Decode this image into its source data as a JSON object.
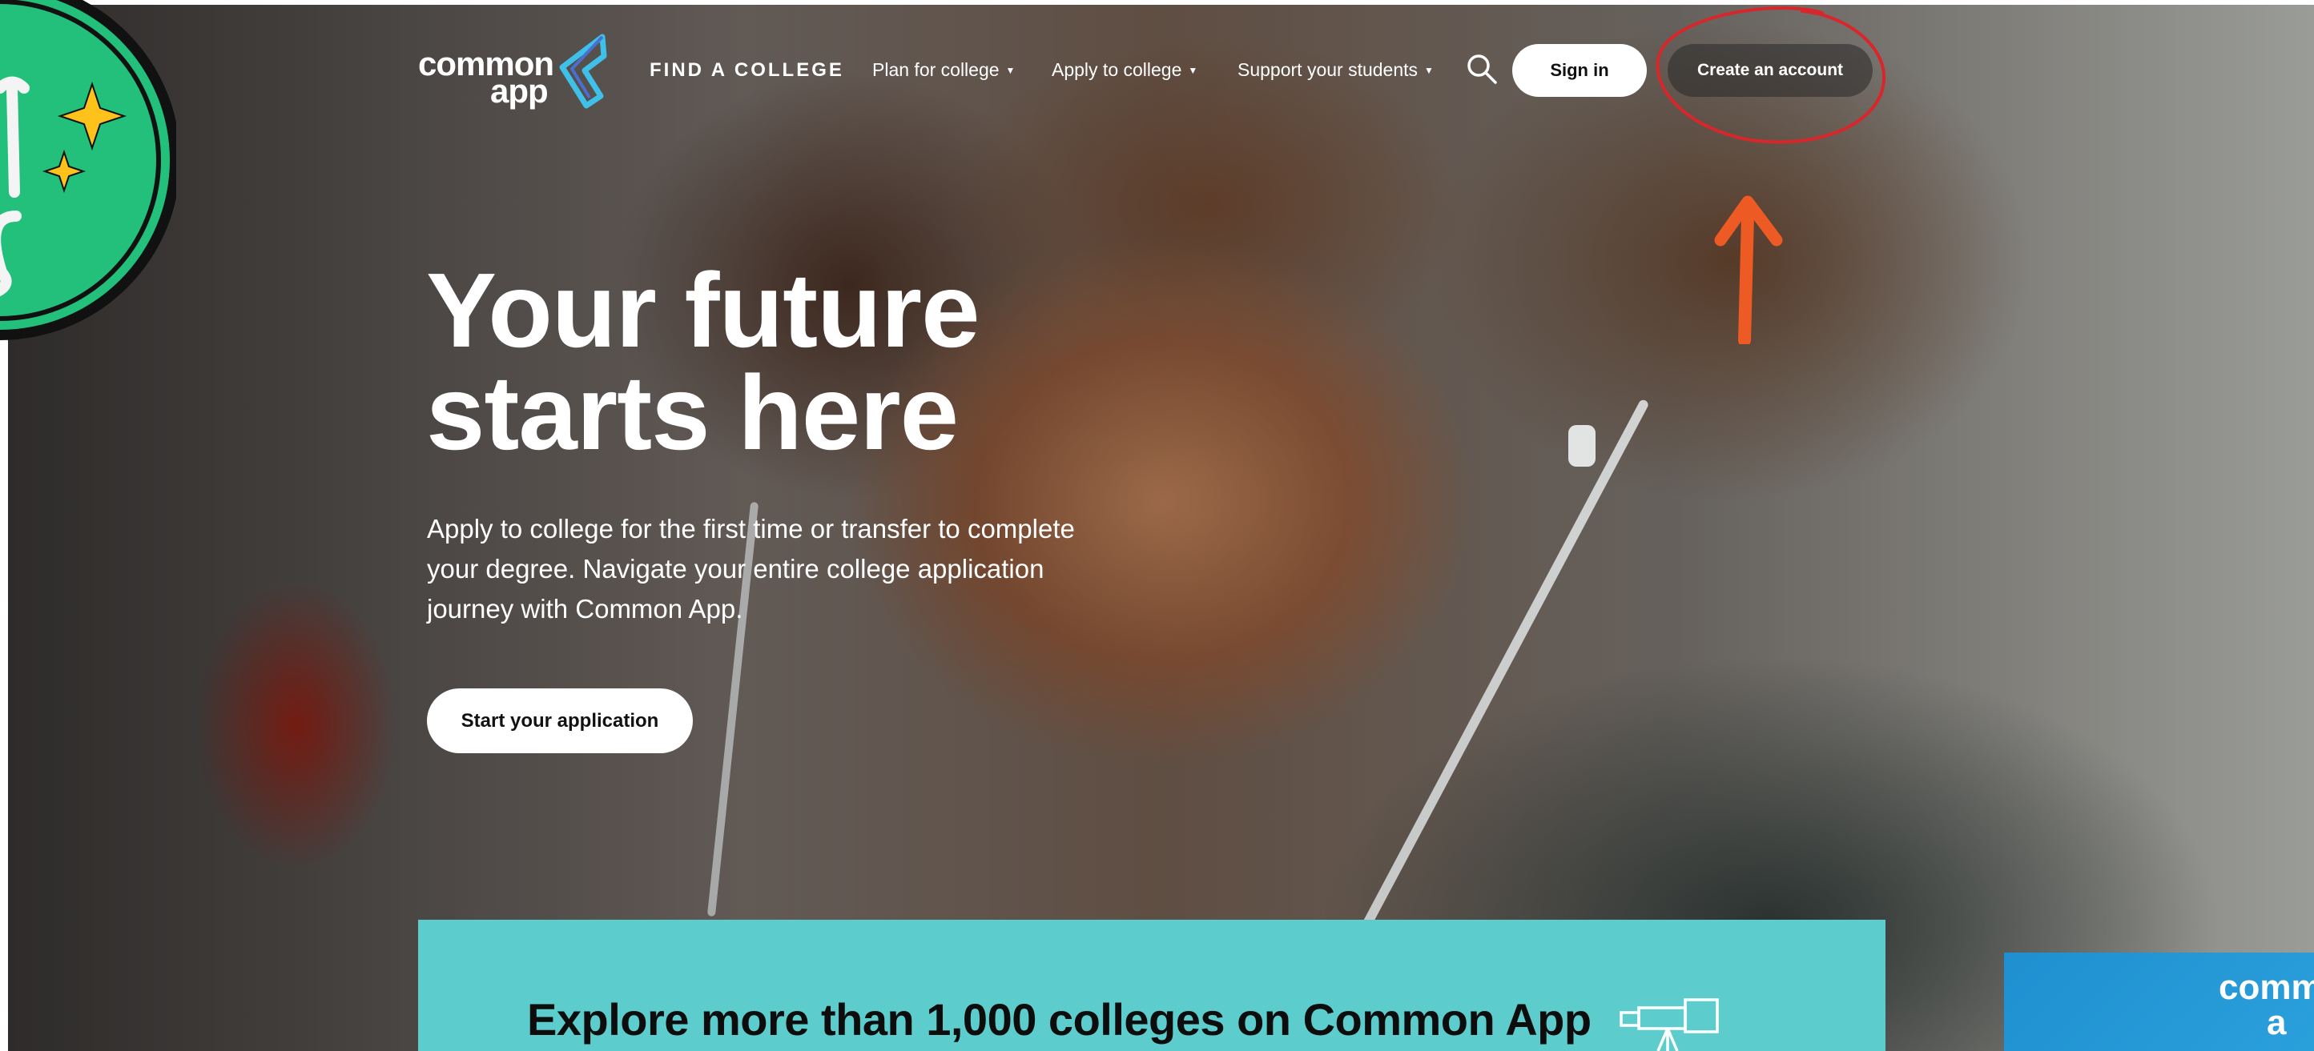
{
  "header": {
    "logo_line1": "common",
    "logo_line2": "app",
    "find_college": "FIND A COLLEGE",
    "nav": [
      {
        "label": "Plan for college",
        "icon": "caret-down-icon"
      },
      {
        "label": "Apply to college",
        "icon": "caret-down-icon"
      },
      {
        "label": "Support your students",
        "icon": "caret-down-icon"
      }
    ],
    "search_icon": "search-icon",
    "sign_in": "Sign in",
    "create_account": "Create an account"
  },
  "hero": {
    "title_line1": "Your future",
    "title_line2": "starts here",
    "subtitle": "Apply to college for the first time or transfer to complete your degree. Navigate your entire college application journey with Common App.",
    "cta": "Start your application"
  },
  "banner": {
    "title": "Explore more than 1,000 colleges on Common App",
    "icon": "telescope-icon"
  },
  "side_card": {
    "line1": "comm",
    "line2": "a"
  },
  "annotations": {
    "circle_color": "#d9262b",
    "arrow_color": "#ee5a24"
  },
  "colors": {
    "brand_accent": "#3fc0e8",
    "banner_teal": "#5ccdcc",
    "sticker_green": "#22c07a",
    "sticker_star": "#ffc21a"
  }
}
